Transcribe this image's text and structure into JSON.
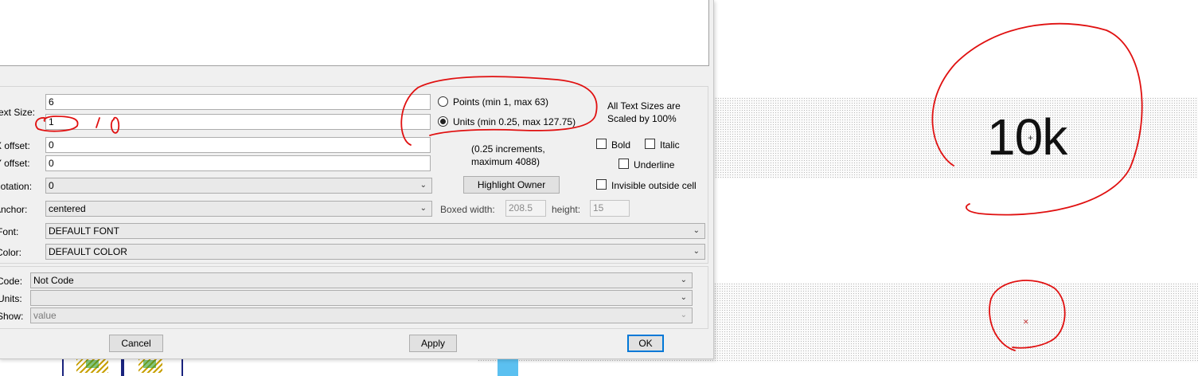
{
  "canvas": {
    "big_text": "10k",
    "cross_mark": "+",
    "small_mark": "✕"
  },
  "dialog": {
    "text_size_label": "Text Size:",
    "text_size_points_value": "6",
    "text_size_units_value": "1",
    "x_offset_label": "X offset:",
    "x_offset_value": "0",
    "y_offset_label": "Y offset:",
    "y_offset_value": "0",
    "rotation_label": "Rotation:",
    "rotation_value": "0",
    "anchor_label": "Anchor:",
    "anchor_value": "centered",
    "font_label": "Font:",
    "font_value": "DEFAULT FONT",
    "color_label": "Color:",
    "color_value": "DEFAULT COLOR",
    "radio_points_label": "Points (min 1, max 63)",
    "radio_units_label": "Units (min 0.25, max 127.75)",
    "units_selected": true,
    "increments_note_line1": "(0.25 increments,",
    "increments_note_line2": "maximum 4088)",
    "scaled_note_line1": "All Text Sizes are",
    "scaled_note_line2": "Scaled by 100%",
    "bold_label": "Bold",
    "italic_label": "Italic",
    "underline_label": "Underline",
    "highlight_owner_label": "Highlight Owner",
    "invisible_outside_label": "Invisible outside cell",
    "boxed_width_label": "Boxed width:",
    "boxed_width_value": "208.5",
    "height_label": "height:",
    "height_value": "15",
    "code_label": "Code:",
    "code_value": "Not Code",
    "units_label": "Units:",
    "units_value": "",
    "show_label": "Show:",
    "show_value": "value",
    "cancel_label": "Cancel",
    "apply_label": "Apply",
    "ok_label": "OK"
  },
  "annotation": {
    "handwritten_note": "10",
    "ink_color": "#e01010"
  }
}
